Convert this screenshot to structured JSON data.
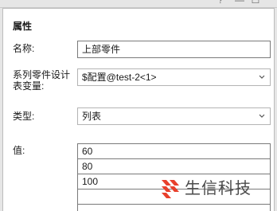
{
  "window": {
    "help_glyph": "?",
    "minimize_glyph": "—",
    "maximize_glyph": "☐"
  },
  "properties": {
    "group_title": "属性",
    "name_label": "名称:",
    "name_value": "上部零件",
    "variable_label_line1": "系列零件设计",
    "variable_label_line2": "表变量:",
    "variable_value": "$配置@test-2<1>",
    "type_label": "类型:",
    "type_value": "列表",
    "values_label": "值:",
    "values": [
      "60",
      "80",
      "100",
      ""
    ]
  },
  "watermark": {
    "text": "生信科技",
    "logo_color": "#e8402c"
  },
  "icons": {
    "dropdown": "chevron-down-icon",
    "logo": "stripes-logo-icon"
  }
}
